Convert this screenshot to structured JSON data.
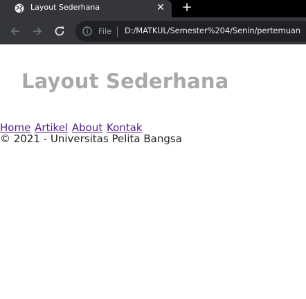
{
  "browser": {
    "tab": {
      "title": "Layout Sederhana",
      "close_glyph": "✕",
      "icon": "globe-icon"
    },
    "new_tab_glyph": "+",
    "toolbar": {
      "back_icon": "arrow-left-icon",
      "forward_icon": "arrow-right-icon",
      "reload_icon": "reload-icon"
    },
    "omnibox": {
      "scheme_label": "File",
      "url": "D:/MATKUL/Semester%204/Senin/pertemuan",
      "info_icon": "info-icon"
    },
    "colors": {
      "tabstrip": "#000000",
      "toolbar": "#35363a",
      "omnibox": "#202124"
    }
  },
  "page": {
    "title": "Layout Sederhana",
    "nav": {
      "items": [
        {
          "label": "Home"
        },
        {
          "label": "Artikel"
        },
        {
          "label": "About"
        },
        {
          "label": "Kontak"
        }
      ]
    },
    "footer": "© 2021 - Universitas Pelita Bangsa",
    "colors": {
      "title": "#a8a8a8",
      "link": "#551a8b"
    }
  }
}
